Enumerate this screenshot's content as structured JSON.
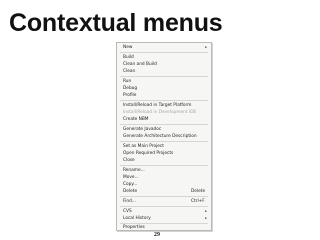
{
  "slide": {
    "title": "Contextual menus",
    "page_number": "29"
  },
  "menu": {
    "new": "New",
    "build": "Build",
    "clean_and_build": "Clean and Build",
    "clean": "Clean",
    "run": "Run",
    "debug": "Debug",
    "profile": "Profile",
    "install_reload": "Install/Reload in Target Platform",
    "install_reload_dev": "Install/Reload in Development IDE",
    "create_nbm": "Create NBM",
    "generate_javadoc": "Generate Javadoc",
    "generate_architecture": "Generate Architecture Description",
    "set_main_project": "Set as Main Project",
    "open_required_projects": "Open Required Projects",
    "close": "Close",
    "rename": "Rename...",
    "move": "Move...",
    "copy": "Copy...",
    "delete": "Delete",
    "delete_shortcut": "Delete",
    "find": "Find...",
    "find_shortcut": "Ctrl+F",
    "cvs": "CVS",
    "local_history": "Local History",
    "properties": "Properties",
    "submenu_arrow": "▸"
  }
}
